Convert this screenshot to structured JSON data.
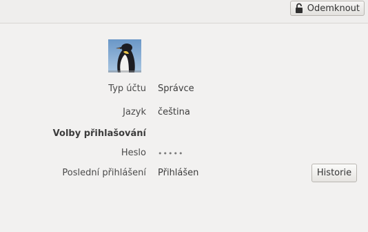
{
  "toolbar": {
    "unlock_label": "Odemknout",
    "unlock_icon": "lock-icon"
  },
  "account": {
    "avatar_icon": "penguin-avatar",
    "type_label": "Typ účtu",
    "type_value": "Správce",
    "language_label": "Jazyk",
    "language_value": "čeština"
  },
  "login_options": {
    "heading": "Volby přihlašování",
    "password_label": "Heslo",
    "password_value": "•••••",
    "last_login_label": "Poslední přihlášení",
    "last_login_value": "Přihlášen",
    "history_button": "Historie"
  }
}
